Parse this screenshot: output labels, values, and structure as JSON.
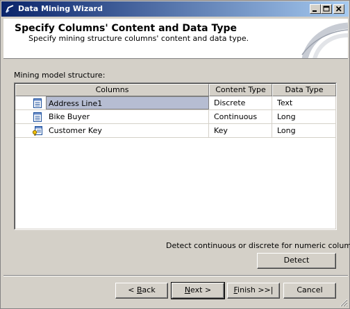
{
  "window": {
    "title": "Data Mining Wizard"
  },
  "header": {
    "title": "Specify Columns' Content and Data Type",
    "subtitle": "Specify mining structure columns' content and data type."
  },
  "structure_label": "Mining model structure:",
  "grid": {
    "columns": [
      "Columns",
      "Content Type",
      "Data Type"
    ],
    "rows": [
      {
        "name": "Address Line1",
        "content_type": "Discrete",
        "data_type": "Text",
        "icon": "column-icon",
        "selected": true
      },
      {
        "name": "Bike Buyer",
        "content_type": "Continuous",
        "data_type": "Long",
        "icon": "column-icon",
        "selected": false
      },
      {
        "name": "Customer Key",
        "content_type": "Key",
        "data_type": "Long",
        "icon": "key-column-icon",
        "selected": false
      }
    ]
  },
  "detect": {
    "label": "Detect continuous or discrete for numeric columns:",
    "button": "Detect"
  },
  "buttons": {
    "back_prefix": "< ",
    "back_mnemonic": "B",
    "back_rest": "ack",
    "next_mnemonic": "N",
    "next_rest": "ext >",
    "finish_mnemonic": "F",
    "finish_rest": "inish >>|",
    "cancel": "Cancel"
  },
  "colors": {
    "titlebar_start": "#0a246a",
    "titlebar_end": "#a6caf0",
    "selection": "#b6bdd2",
    "dialog_face": "#d4d0c8"
  }
}
